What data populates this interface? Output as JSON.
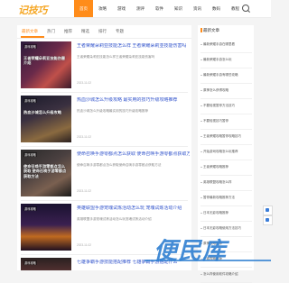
{
  "header": {
    "logo_text": "记技巧",
    "nav": [
      "首页",
      "攻略",
      "游戏",
      "测评",
      "软件",
      "知识",
      "资讯",
      "数码",
      "教程"
    ],
    "active_nav": 0
  },
  "main": {
    "tabs": [
      "最新文章",
      "热门",
      "推荐",
      "精选",
      "排行",
      "专题"
    ],
    "articles": [
      {
        "thumb_tag": "游戏攻略",
        "thumb_caption": "王者荣耀朵莉亚技能伤害介绍",
        "title": "王者荣耀朵莉亚技能怎么样 王者荣耀朵莉亚技能伤害吗",
        "summary": "王者荣耀朵莉亚技能怎么样王者荣耀朵莉亚技能伤害吗",
        "date": "2023-11-02"
      },
      {
        "thumb_tag": "游戏攻略",
        "thumb_caption": "热血沙城怎么升级攻略",
        "title": "热血沙城怎么升级攻略 最实用的技巧升级攻略推荐",
        "summary": "热血沙城怎么升级攻略最实用的技巧升级攻略推荐",
        "date": "2023-11-02"
      },
      {
        "thumb_tag": "游戏攻略",
        "thumb_caption": "使命召唤手游零都点怎么获取 使命召唤手游零都点获取方法",
        "title": "使命召唤手游零都点怎么获取 使命召唤手游零都点获取方法",
        "summary": "使命召唤手游零都点怎么获取使命召唤手游零都点获取方法",
        "date": "2023-11-02"
      },
      {
        "thumb_tag": "游戏攻略",
        "thumb_caption": "",
        "title": "英雄联盟手游宠魂试炼活动怎么玩 宠魂试炼活动介绍",
        "summary": "英雄联盟手游宠魂试炼活动怎么玩宠魂试炼活动介绍",
        "date": "2023-11-02"
      },
      {
        "thumb_tag": "游戏攻略",
        "thumb_caption": "",
        "title": "七雄争霸手游技能搭配推荐 七雄争霸手游搭配什么",
        "summary": "",
        "date": ""
      }
    ]
  },
  "sidebar": {
    "heading": "最新文章",
    "items": [
      "最新荣耀手游在哪里看",
      "最新荣耀手游怎么玩",
      "最新荣耀手游有哪些攻略",
      "原神怎么获得攻略",
      "不要轻视暂停方法技巧",
      "不要轻视技巧暂停",
      "王者荣耀攻略暂停攻略技巧",
      "开始游戏攻略怎么玩推荐",
      "王者荣耀攻略推荐",
      "英雄联盟攻略怎么样",
      "暂停最新攻略推荐方法",
      "日本无影攻略推荐",
      "日本无影攻略使用方法技巧",
      "原神攻略推荐",
      "王者攻略推荐",
      "怎么样使用软件攻略介绍"
    ]
  },
  "watermark": "便民库",
  "colors": {
    "accent": "#ff8c1a",
    "link": "#3355cc",
    "watermark": "#2f7fd1"
  }
}
